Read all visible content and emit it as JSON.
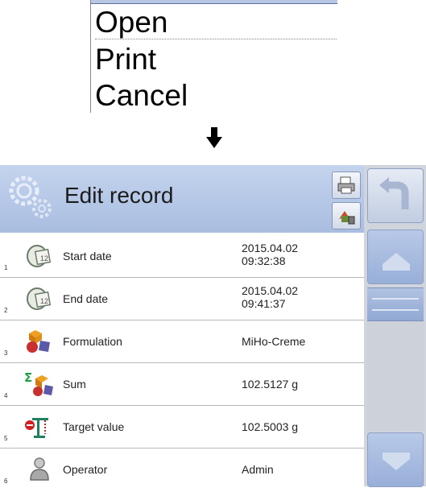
{
  "context_menu": {
    "items": [
      "Open",
      "Print",
      "Cancel"
    ]
  },
  "screen": {
    "title": "Edit record",
    "rows": [
      {
        "num": "1",
        "label": "Start date",
        "value_line1": "2015.04.02",
        "value_line2": "09:32:38",
        "icon": "calendar-icon"
      },
      {
        "num": "2",
        "label": "End date",
        "value_line1": "2015.04.02",
        "value_line2": "09:41:37",
        "icon": "calendar-icon"
      },
      {
        "num": "3",
        "label": "Formulation",
        "value_line1": "MiHo-Creme",
        "value_line2": "",
        "icon": "formulation-icon"
      },
      {
        "num": "4",
        "label": "Sum",
        "value_line1": "102.5127 g",
        "value_line2": "",
        "icon": "sum-icon"
      },
      {
        "num": "5",
        "label": "Target value",
        "value_line1": "102.5003 g",
        "value_line2": "",
        "icon": "target-icon"
      },
      {
        "num": "6",
        "label": "Operator",
        "value_line1": "Admin",
        "value_line2": "",
        "icon": "operator-icon"
      }
    ]
  },
  "colors": {
    "header_gradient_top": "#c4d4ee",
    "header_gradient_bottom": "#a9bde0",
    "side_panel": "#d0d4dc",
    "button_blue": "#98afd8"
  }
}
